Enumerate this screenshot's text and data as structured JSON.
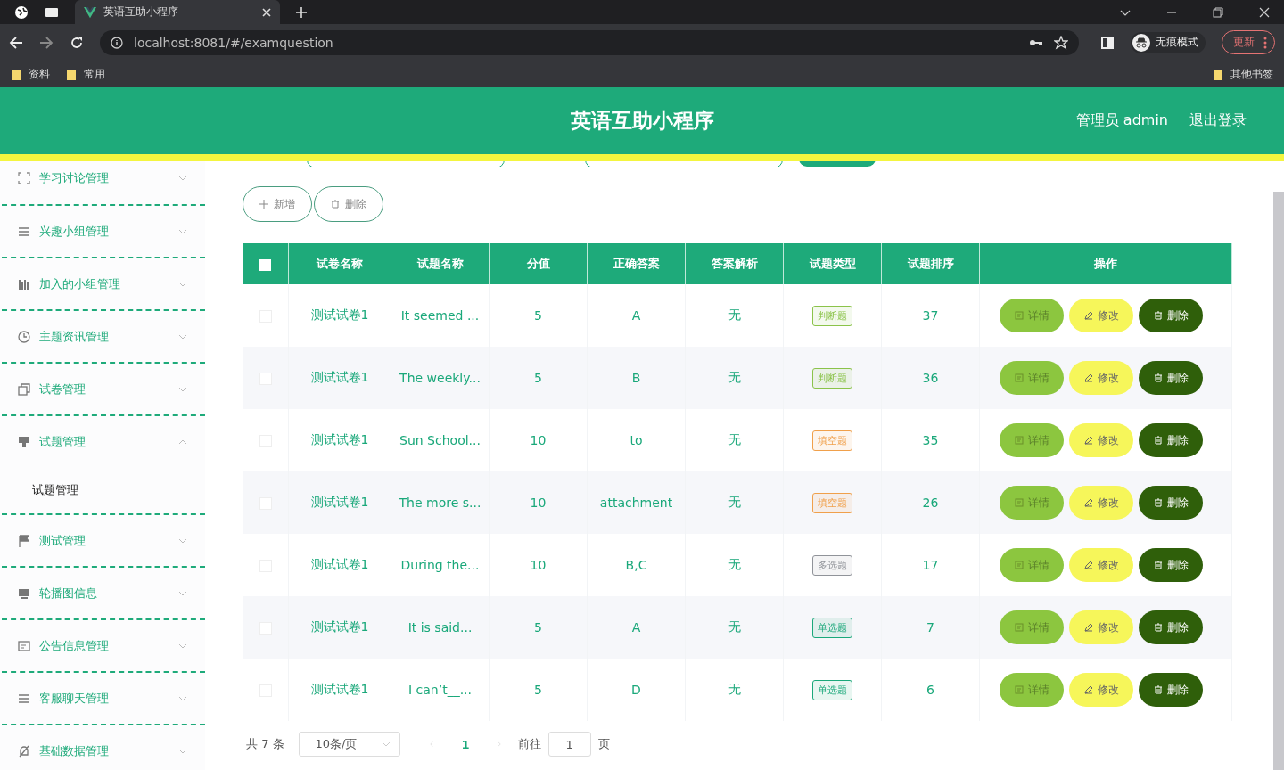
{
  "browser": {
    "tab_title": "英语互助小程序",
    "url": "localhost:8081/#/examquestion",
    "bookmarks": [
      "资料",
      "常用"
    ],
    "other_bookmarks": "其他书签",
    "profile_label": "无痕模式",
    "update_label": "更新"
  },
  "header": {
    "title": "英语互助小程序",
    "user": "管理员 admin",
    "logout": "退出登录"
  },
  "sidebar": {
    "items": [
      {
        "label": "学习讨论管理",
        "expanded": false
      },
      {
        "label": "兴趣小组管理",
        "expanded": false
      },
      {
        "label": "加入的小组管理",
        "expanded": false
      },
      {
        "label": "主题资讯管理",
        "expanded": false
      },
      {
        "label": "试卷管理",
        "expanded": false
      },
      {
        "label": "试题管理",
        "expanded": true,
        "children": [
          {
            "label": "试题管理"
          }
        ]
      },
      {
        "label": "测试管理",
        "expanded": false
      },
      {
        "label": "轮播图信息",
        "expanded": false
      },
      {
        "label": "公告信息管理",
        "expanded": false
      },
      {
        "label": "客服聊天管理",
        "expanded": false
      },
      {
        "label": "基础数据管理",
        "expanded": false
      }
    ]
  },
  "toolbar": [
    {
      "kind": "add",
      "label": "新增"
    },
    {
      "kind": "delete",
      "label": "删除"
    }
  ],
  "table": {
    "all_selected": false,
    "columns": [
      "试卷名称",
      "试题名称",
      "分值",
      "正确答案",
      "答案解析",
      "试题类型",
      "试题排序",
      "操作"
    ],
    "rows": [
      {
        "selected": false,
        "paper": "测试试卷1",
        "question": "It seemed ...",
        "score": "5",
        "answer": "A",
        "analysis": "无",
        "type": {
          "label": "判断题",
          "color": "#8bc34a"
        },
        "order": "37",
        "actions": [
          "详情",
          "修改",
          "删除"
        ]
      },
      {
        "selected": false,
        "paper": "测试试卷1",
        "question": "The weekly...",
        "score": "5",
        "answer": "B",
        "analysis": "无",
        "type": {
          "label": "判断题",
          "color": "#8bc34a"
        },
        "order": "36",
        "actions": [
          "详情",
          "修改",
          "删除"
        ]
      },
      {
        "selected": false,
        "paper": "测试试卷1",
        "question": "Sun School...",
        "score": "10",
        "answer": "to",
        "analysis": "无",
        "type": {
          "label": "填空题",
          "color": "#f0a04b"
        },
        "order": "35",
        "actions": [
          "详情",
          "修改",
          "删除"
        ]
      },
      {
        "selected": false,
        "paper": "测试试卷1",
        "question": "The more s...",
        "score": "10",
        "answer": "attachment",
        "analysis": "无",
        "type": {
          "label": "填空题",
          "color": "#f0a04b"
        },
        "order": "26",
        "actions": [
          "详情",
          "修改",
          "删除"
        ]
      },
      {
        "selected": false,
        "paper": "测试试卷1",
        "question": "During the...",
        "score": "10",
        "answer": "B,C",
        "analysis": "无",
        "type": {
          "label": "多选题",
          "color": "#909399"
        },
        "order": "17",
        "actions": [
          "详情",
          "修改",
          "删除"
        ]
      },
      {
        "selected": false,
        "paper": "测试试卷1",
        "question": "It is said...",
        "score": "5",
        "answer": "A",
        "analysis": "无",
        "type": {
          "label": "单选题",
          "color": "#1aa87a"
        },
        "order": "7",
        "actions": [
          "详情",
          "修改",
          "删除"
        ]
      },
      {
        "selected": false,
        "paper": "测试试卷1",
        "question": "I can’t__...",
        "score": "5",
        "answer": "D",
        "analysis": "无",
        "type": {
          "label": "单选题",
          "color": "#1aa87a"
        },
        "order": "6",
        "actions": [
          "详情",
          "修改",
          "删除"
        ]
      }
    ]
  },
  "pagination": {
    "total": "共 7 条",
    "page_size": "10条/页",
    "pages": [
      {
        "label": "1",
        "selected": true
      }
    ],
    "goto_label": "前往",
    "goto_value": "1",
    "goto_suffix": "页"
  }
}
